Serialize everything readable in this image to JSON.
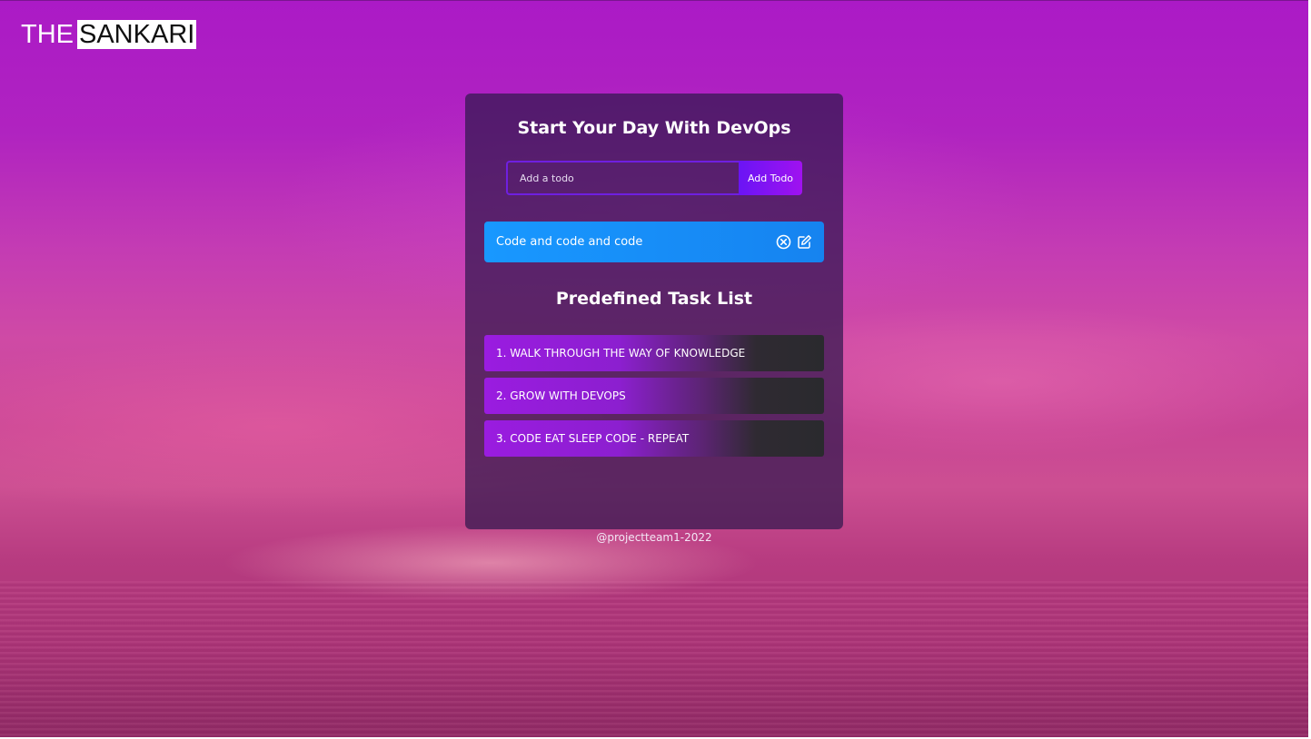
{
  "brand": {
    "prefix": "THE",
    "name": "SANKARI"
  },
  "card": {
    "title": "Start Your Day With DevOps",
    "input": {
      "placeholder": "Add a todo",
      "value": ""
    },
    "add_button_label": "Add Todo",
    "todos": [
      {
        "text": "Code and code and code",
        "remove_icon": "circle-x-icon",
        "edit_icon": "edit-icon"
      }
    ],
    "predefined_title": "Predefined Task List",
    "predefined_tasks": [
      "1. WALK THROUGH THE WAY OF KNOWLEDGE",
      "2. GROW WITH DEVOPS",
      "3. CODE EAT SLEEP CODE - REPEAT"
    ]
  },
  "footer": {
    "text": "@projectteam1-2022"
  },
  "colors": {
    "todo_row": "#1898ff",
    "add_button": "#8a13f2",
    "input_border": "#6f1fe0",
    "task_gradient_start": "#9a1ce0",
    "task_gradient_end": "#2a2a2e"
  }
}
